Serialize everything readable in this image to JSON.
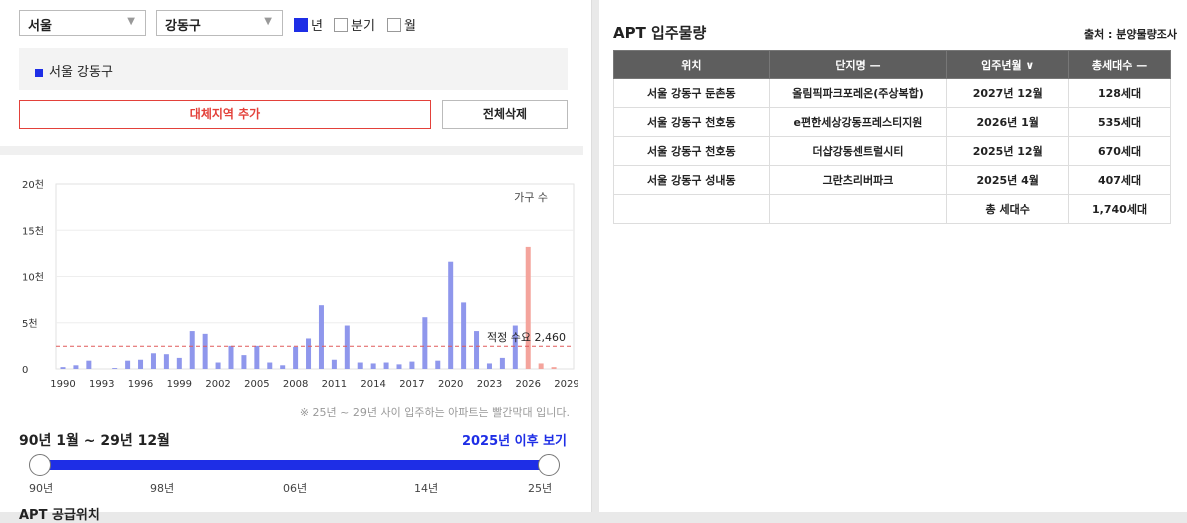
{
  "filters": {
    "city": "서울",
    "district": "강동구",
    "periods": [
      {
        "label": "년",
        "checked": true
      },
      {
        "label": "분기",
        "checked": false
      },
      {
        "label": "월",
        "checked": false
      }
    ]
  },
  "selected_region": "서울 강동구",
  "buttons": {
    "add_region": "대체지역 추가",
    "delete_all": "전체삭제"
  },
  "chart_data": {
    "type": "bar",
    "legend": "가구 수",
    "y_ticks": [
      "20천",
      "15천",
      "10천",
      "5천",
      "0"
    ],
    "ylim": [
      0,
      20000
    ],
    "x_ticks": [
      "1990",
      "1993",
      "1996",
      "1999",
      "2002",
      "2005",
      "2008",
      "2011",
      "2014",
      "2017",
      "2020",
      "2023",
      "2026",
      "2029"
    ],
    "x": [
      1990,
      1991,
      1992,
      1993,
      1994,
      1995,
      1996,
      1997,
      1998,
      1999,
      2000,
      2001,
      2002,
      2003,
      2004,
      2005,
      2006,
      2007,
      2008,
      2009,
      2010,
      2011,
      2012,
      2013,
      2014,
      2015,
      2016,
      2017,
      2018,
      2019,
      2020,
      2021,
      2022,
      2023,
      2024,
      2025,
      2026,
      2027,
      2028,
      2029
    ],
    "values": [
      200,
      400,
      900,
      0,
      100,
      900,
      1000,
      1700,
      1600,
      1200,
      4100,
      3800,
      700,
      2500,
      1500,
      2500,
      700,
      400,
      2400,
      3300,
      6900,
      1000,
      4700,
      700,
      600,
      700,
      500,
      800,
      5600,
      900,
      11600,
      7200,
      4100,
      600,
      1200,
      4700,
      13200,
      600,
      200,
      0
    ],
    "future_start_year": 2025,
    "reference_line": {
      "label": "적정 수요",
      "value": 2460,
      "value_label": "2,460"
    },
    "colors": {
      "past": "#8f97ec",
      "future": "#f4a49c",
      "reference": "#e05a5a"
    }
  },
  "chart_note": "※ 25년 ~ 29년 사이 입주하는 아파트는 빨간막대 입니다.",
  "range": {
    "label": "90년 1월 ~ 29년 12월",
    "future_link": "2025년 이후 보기",
    "ticks": [
      "90년",
      "98년",
      "06년",
      "14년",
      "25년"
    ]
  },
  "bottom_title": "APT 공급위치",
  "supply_table": {
    "title": "APT 입주물량",
    "source": "출처 : 분양물량조사",
    "headers": [
      "위치",
      "단지명 —",
      "입주년월 ∨",
      "총세대수 —"
    ],
    "rows": [
      [
        "서울 강동구 둔촌동",
        "올림픽파크포레온(주상복합)",
        "2027년 12월",
        "128세대"
      ],
      [
        "서울 강동구 천호동",
        "e편한세상강동프레스티지원",
        "2026년 1월",
        "535세대"
      ],
      [
        "서울 강동구 천호동",
        "더샵강동센트럴시티",
        "2025년 12월",
        "670세대"
      ],
      [
        "서울 강동구 성내동",
        "그란츠리버파크",
        "2025년 4월",
        "407세대"
      ]
    ],
    "total_label": "총 세대수",
    "total_value": "1,740세대"
  }
}
